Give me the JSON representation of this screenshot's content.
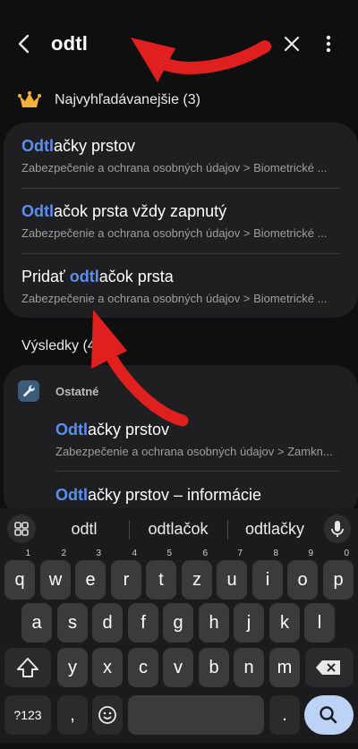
{
  "header": {
    "search_query": "odtl",
    "back_icon": "back-arrow-icon",
    "close_icon": "close-icon",
    "more_icon": "more-vert-icon"
  },
  "top_section": {
    "title": "Najvyhľadávanejšie (3)",
    "icon": "crown-icon",
    "items": [
      {
        "hl": "Odtl",
        "pre": "",
        "post": "ačky prstov",
        "sub": "Zabezpečenie a ochrana osobných údajov > Biometrické ..."
      },
      {
        "hl": "Odtl",
        "pre": "",
        "post": "ačok prsta vždy zapnutý",
        "sub": "Zabezpečenie a ochrana osobných údajov > Biometrické ..."
      },
      {
        "hl": "odtl",
        "pre": "Pridať ",
        "post": "ačok prsta",
        "sub": "Zabezpečenie a ochrana osobných údajov > Biometrické ..."
      }
    ]
  },
  "results": {
    "title": "Výsledky (4)",
    "category": "Ostatné",
    "category_icon": "wrench-icon",
    "items": [
      {
        "hl": "Odtl",
        "post": "ačky prstov",
        "sub": "Zabezpečenie a ochrana osobných údajov > Zamkn..."
      },
      {
        "hl": "Odtl",
        "post": "ačky prstov – informácie",
        "sub": ""
      }
    ]
  },
  "keyboard": {
    "suggestions": [
      "odtl",
      "odtlačok",
      "odtlačky"
    ],
    "row1": [
      {
        "k": "q",
        "h": "1"
      },
      {
        "k": "w",
        "h": "2"
      },
      {
        "k": "e",
        "h": "3"
      },
      {
        "k": "r",
        "h": "4"
      },
      {
        "k": "t",
        "h": "5"
      },
      {
        "k": "z",
        "h": "6"
      },
      {
        "k": "u",
        "h": "7"
      },
      {
        "k": "i",
        "h": "8"
      },
      {
        "k": "o",
        "h": "9"
      },
      {
        "k": "p",
        "h": "0"
      }
    ],
    "row2": [
      "a",
      "s",
      "d",
      "f",
      "g",
      "h",
      "j",
      "k",
      "l"
    ],
    "row3": [
      "y",
      "x",
      "c",
      "v",
      "b",
      "n",
      "m"
    ],
    "symbols_label": "?123",
    "comma": ",",
    "period": ".",
    "shift_icon": "shift-icon",
    "backspace_icon": "backspace-icon",
    "emoji_icon": "emoji-icon",
    "search_icon": "search-icon",
    "mic_icon": "mic-icon",
    "grid_icon": "grid-icon"
  },
  "colors": {
    "highlight": "#5a8ff2",
    "annotation_arrow": "#e01f1f"
  }
}
